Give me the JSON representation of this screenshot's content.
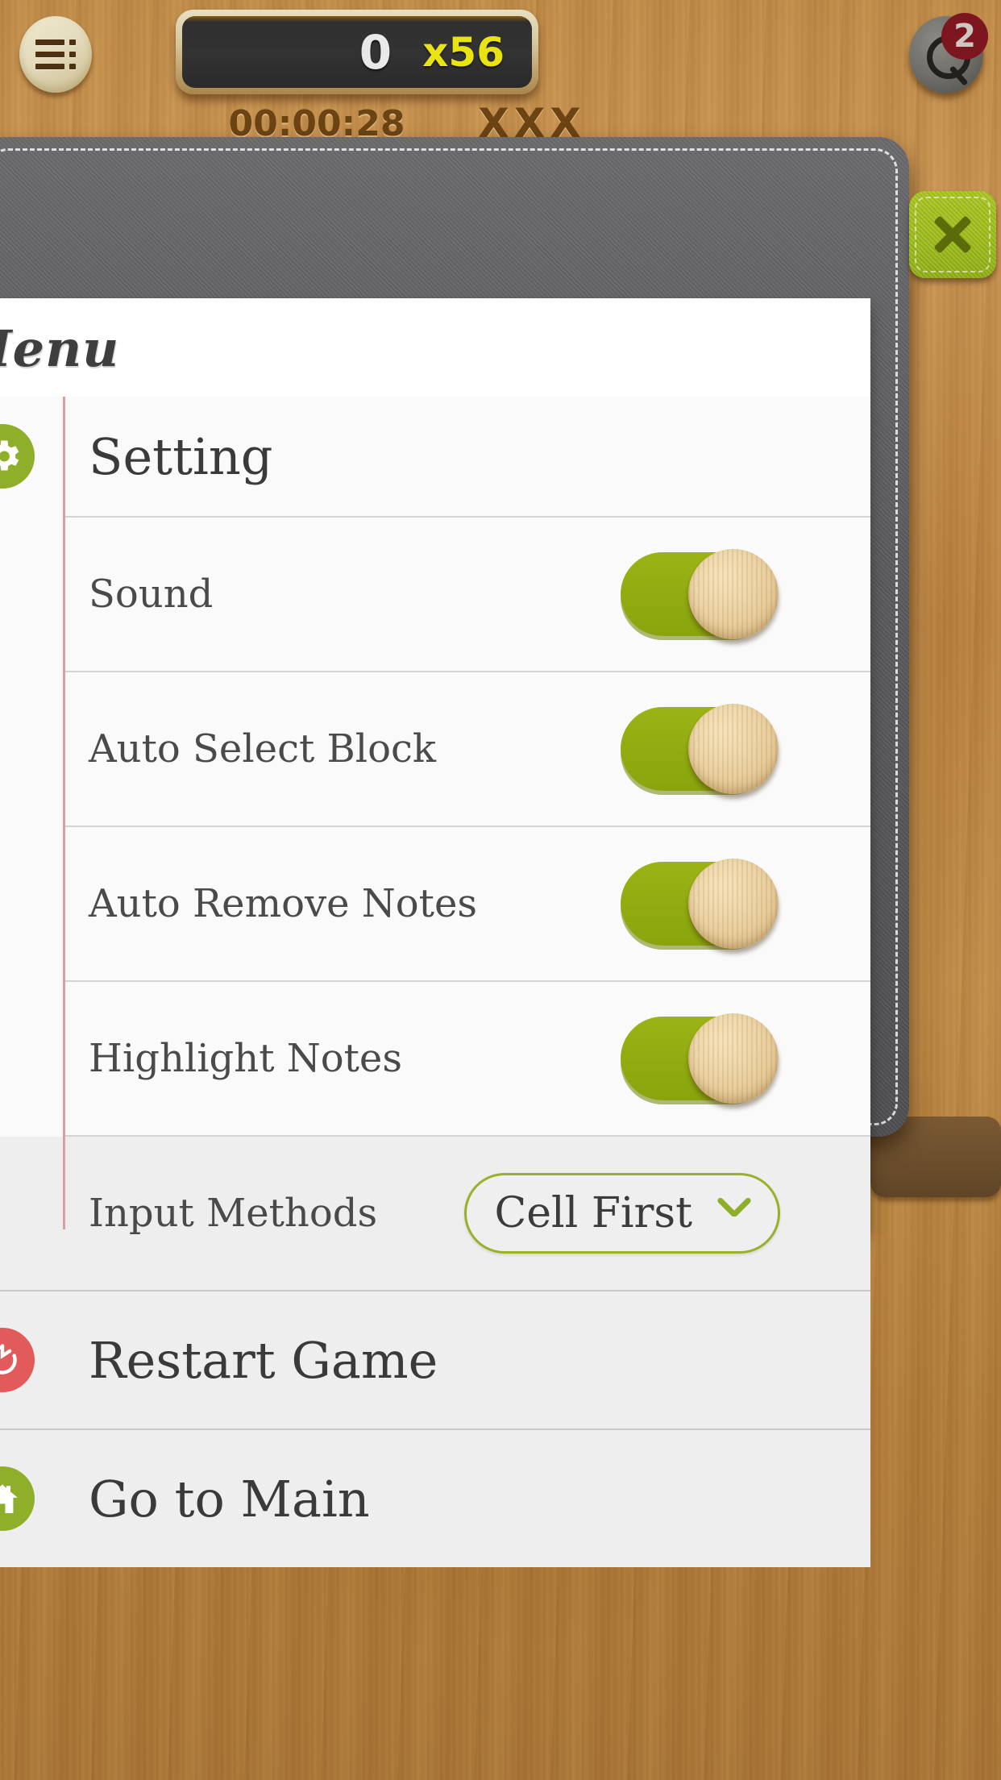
{
  "hud": {
    "menu_icon": "hamburger-icon",
    "score_value": "0",
    "score_multiplier": "x56",
    "timer": "00:00:28",
    "lives": "XXX",
    "search_icon": "search-icon",
    "search_badge": "2"
  },
  "modal": {
    "title": "Menu",
    "close_label": "×",
    "close_icon": "close-icon",
    "rows": [
      {
        "kind": "header",
        "icon": "gear-icon",
        "icon_color": "#8fae2a",
        "label": "Setting"
      },
      {
        "kind": "toggle",
        "label": "Sound",
        "state": "on"
      },
      {
        "kind": "toggle",
        "label": "Auto Select Block",
        "state": "on"
      },
      {
        "kind": "toggle",
        "label": "Auto Remove Notes",
        "state": "on"
      },
      {
        "kind": "toggle",
        "label": "Highlight Notes",
        "state": "on"
      },
      {
        "kind": "select",
        "label": "Input Methods",
        "value": "Cell First",
        "chevron": "chevron-down-icon"
      },
      {
        "kind": "action",
        "icon": "restart-icon",
        "icon_color": "#e25b5b",
        "label": "Restart Game"
      },
      {
        "kind": "action",
        "icon": "home-icon",
        "icon_color": "#8fae2a",
        "label": "Go to Main"
      }
    ]
  },
  "colors": {
    "accent_green": "#8fae2a",
    "toggle_green": "#9ab315",
    "restart_red": "#e25b5b",
    "rail_pink": "#d9a0a0",
    "frame_grey": "#5b5b5e",
    "wood": "#b8803c"
  }
}
